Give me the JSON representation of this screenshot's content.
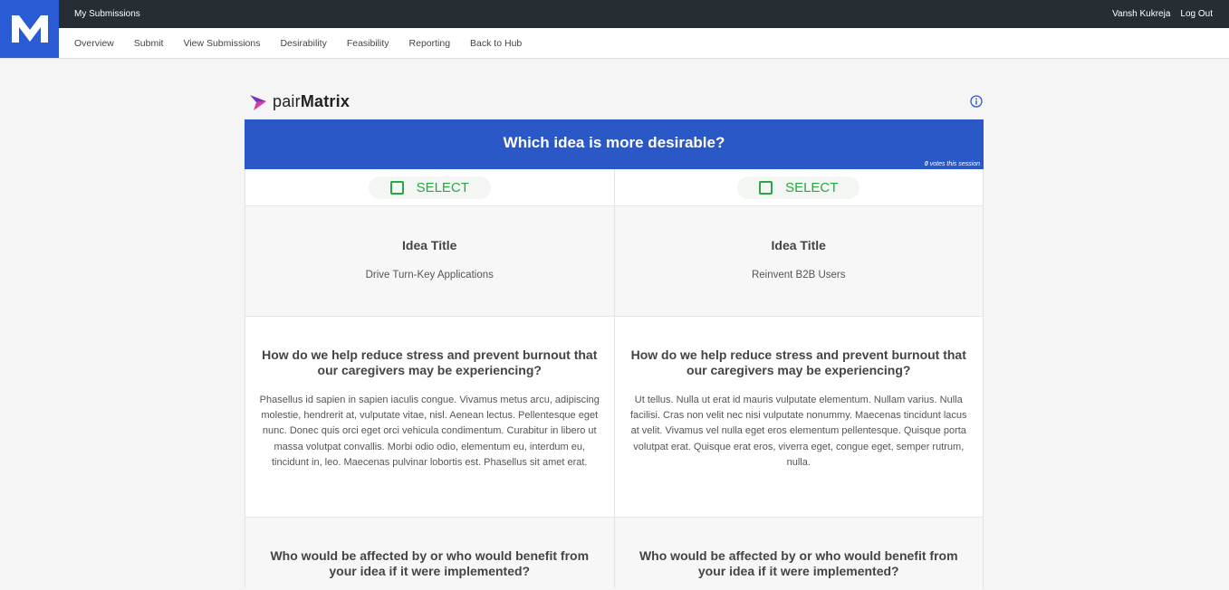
{
  "header": {
    "app_title": "My Submissions",
    "user_name": "Vansh Kukreja",
    "logout_label": "Log Out"
  },
  "nav": {
    "items": [
      "Overview",
      "Submit",
      "View Submissions",
      "Desirability",
      "Feasibility",
      "Reporting",
      "Back to Hub"
    ]
  },
  "pairmatrix": {
    "logo_prefix": "pair",
    "logo_suffix": "Matrix",
    "banner_question": "Which idea is more desirable?",
    "votes_count": "0",
    "votes_suffix": " votes this session"
  },
  "ideas": [
    {
      "select_label": "SELECT",
      "title_label": "Idea Title",
      "title_value": "Drive Turn-Key Applications",
      "q1": "How do we help reduce stress and prevent burnout that our caregivers may be experiencing?",
      "a1": "Phasellus id sapien in sapien iaculis congue. Vivamus metus arcu, adipiscing molestie, hendrerit at, vulputate vitae, nisl. Aenean lectus. Pellentesque eget nunc. Donec quis orci eget orci vehicula condimentum. Curabitur in libero ut massa volutpat convallis. Morbi odio odio, elementum eu, interdum eu, tincidunt in, leo. Maecenas pulvinar lobortis est. Phasellus sit amet erat.",
      "q2": "Who would be affected by or who would benefit from your idea if it were implemented?"
    },
    {
      "select_label": "SELECT",
      "title_label": "Idea Title",
      "title_value": "Reinvent B2B Users",
      "q1": "How do we help reduce stress and prevent burnout that our caregivers may be experiencing?",
      "a1": "Ut tellus. Nulla ut erat id mauris vulputate elementum. Nullam varius. Nulla facilisi. Cras non velit nec nisi vulputate nonummy. Maecenas tincidunt lacus at velit. Vivamus vel nulla eget eros elementum pellentesque. Quisque porta volutpat erat. Quisque erat eros, viverra eget, congue eget, semper rutrum, nulla.",
      "q2": "Who would be affected by or who would benefit from your idea if it were implemented?"
    }
  ],
  "colors": {
    "topbar": "#262d33",
    "brand_blue": "#2a5bd4",
    "banner_blue": "#2b58c7",
    "select_green": "#28a745"
  },
  "icons": [
    "app-logo-icon",
    "pairmatrix-logo-icon",
    "info-icon",
    "checkbox-icon"
  ]
}
